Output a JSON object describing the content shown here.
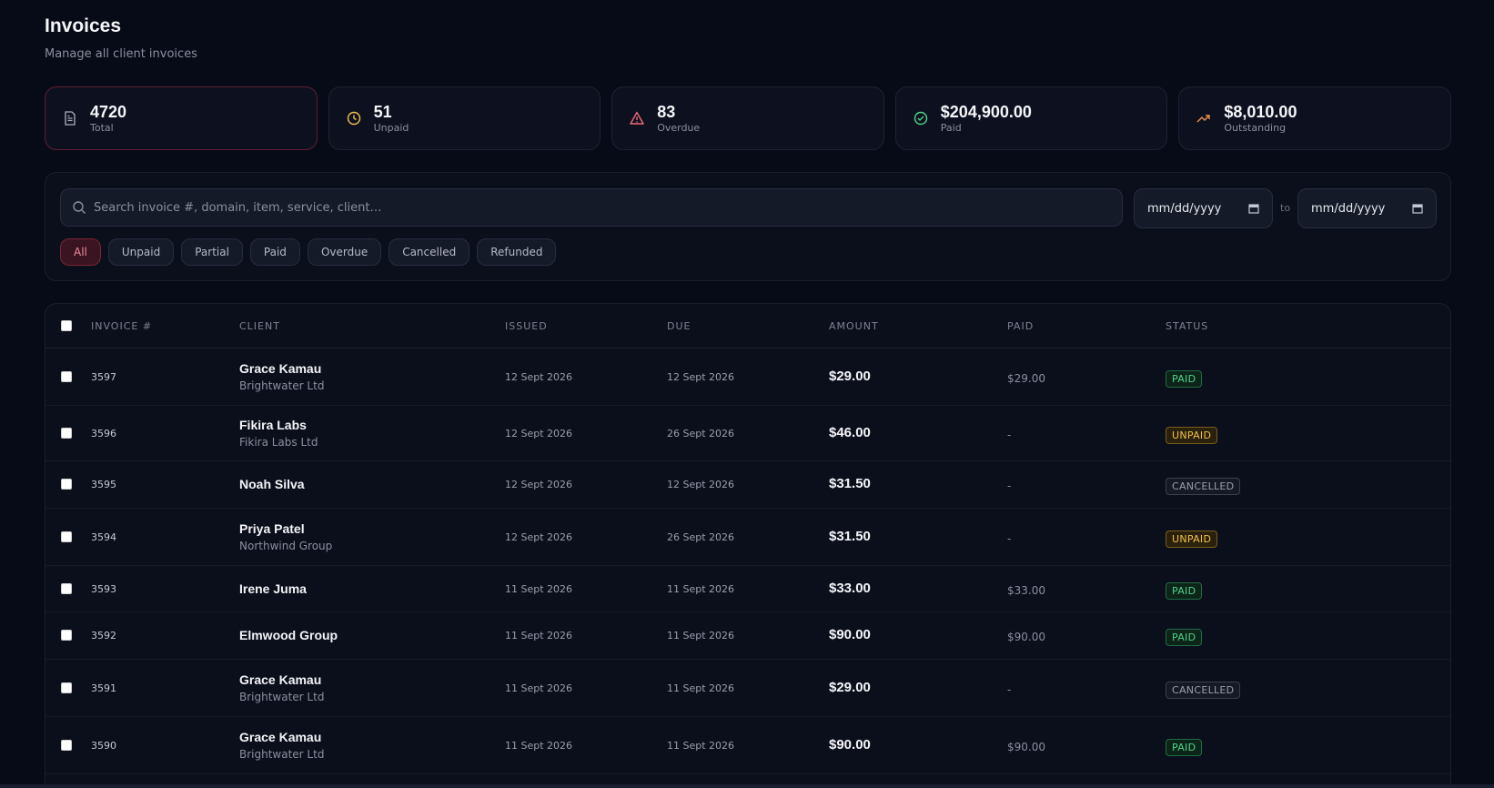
{
  "header": {
    "title": "Invoices",
    "subtitle": "Manage all client invoices"
  },
  "stats": [
    {
      "value": "4720",
      "label": "Total",
      "icon": "document-icon"
    },
    {
      "value": "51",
      "label": "Unpaid",
      "icon": "clock-icon"
    },
    {
      "value": "83",
      "label": "Overdue",
      "icon": "warning-icon"
    },
    {
      "value": "$204,900.00",
      "label": "Paid",
      "icon": "check-circle-icon"
    },
    {
      "value": "$8,010.00",
      "label": "Outstanding",
      "icon": "trending-up-icon"
    }
  ],
  "filters": {
    "search_placeholder": "Search invoice #, domain, item, service, client…",
    "date_from": "mm/dd/yyyy",
    "date_to": "mm/dd/yyyy",
    "to_label": "to",
    "chips": [
      "All",
      "Unpaid",
      "Partial",
      "Paid",
      "Overdue",
      "Cancelled",
      "Refunded"
    ],
    "active_chip": "All"
  },
  "table": {
    "columns": [
      "INVOICE #",
      "CLIENT",
      "ISSUED",
      "DUE",
      "AMOUNT",
      "PAID",
      "STATUS"
    ],
    "rows": [
      {
        "invoice": "3597",
        "client": "Grace Kamau",
        "org": "Brightwater Ltd",
        "issued": "12 Sept 2026",
        "due": "12 Sept 2026",
        "amount": "$29.00",
        "paid": "$29.00",
        "status": "PAID"
      },
      {
        "invoice": "3596",
        "client": "Fikira Labs",
        "org": "Fikira Labs Ltd",
        "issued": "12 Sept 2026",
        "due": "26 Sept 2026",
        "amount": "$46.00",
        "paid": "-",
        "status": "UNPAID"
      },
      {
        "invoice": "3595",
        "client": "Noah Silva",
        "org": "",
        "issued": "12 Sept 2026",
        "due": "12 Sept 2026",
        "amount": "$31.50",
        "paid": "-",
        "status": "CANCELLED"
      },
      {
        "invoice": "3594",
        "client": "Priya Patel",
        "org": "Northwind Group",
        "issued": "12 Sept 2026",
        "due": "26 Sept 2026",
        "amount": "$31.50",
        "paid": "-",
        "status": "UNPAID"
      },
      {
        "invoice": "3593",
        "client": "Irene Juma",
        "org": "",
        "issued": "11 Sept 2026",
        "due": "11 Sept 2026",
        "amount": "$33.00",
        "paid": "$33.00",
        "status": "PAID"
      },
      {
        "invoice": "3592",
        "client": "Elmwood Group",
        "org": "",
        "issued": "11 Sept 2026",
        "due": "11 Sept 2026",
        "amount": "$90.00",
        "paid": "$90.00",
        "status": "PAID"
      },
      {
        "invoice": "3591",
        "client": "Grace Kamau",
        "org": "Brightwater Ltd",
        "issued": "11 Sept 2026",
        "due": "11 Sept 2026",
        "amount": "$29.00",
        "paid": "-",
        "status": "CANCELLED"
      },
      {
        "invoice": "3590",
        "client": "Grace Kamau",
        "org": "Brightwater Ltd",
        "issued": "11 Sept 2026",
        "due": "11 Sept 2026",
        "amount": "$90.00",
        "paid": "$90.00",
        "status": "PAID"
      }
    ]
  },
  "colors": {
    "background": "#070a17",
    "accent": "#f08a9a",
    "paid": "#4cd68a",
    "unpaid": "#f2c04a",
    "cancelled": "#9a9fae"
  }
}
